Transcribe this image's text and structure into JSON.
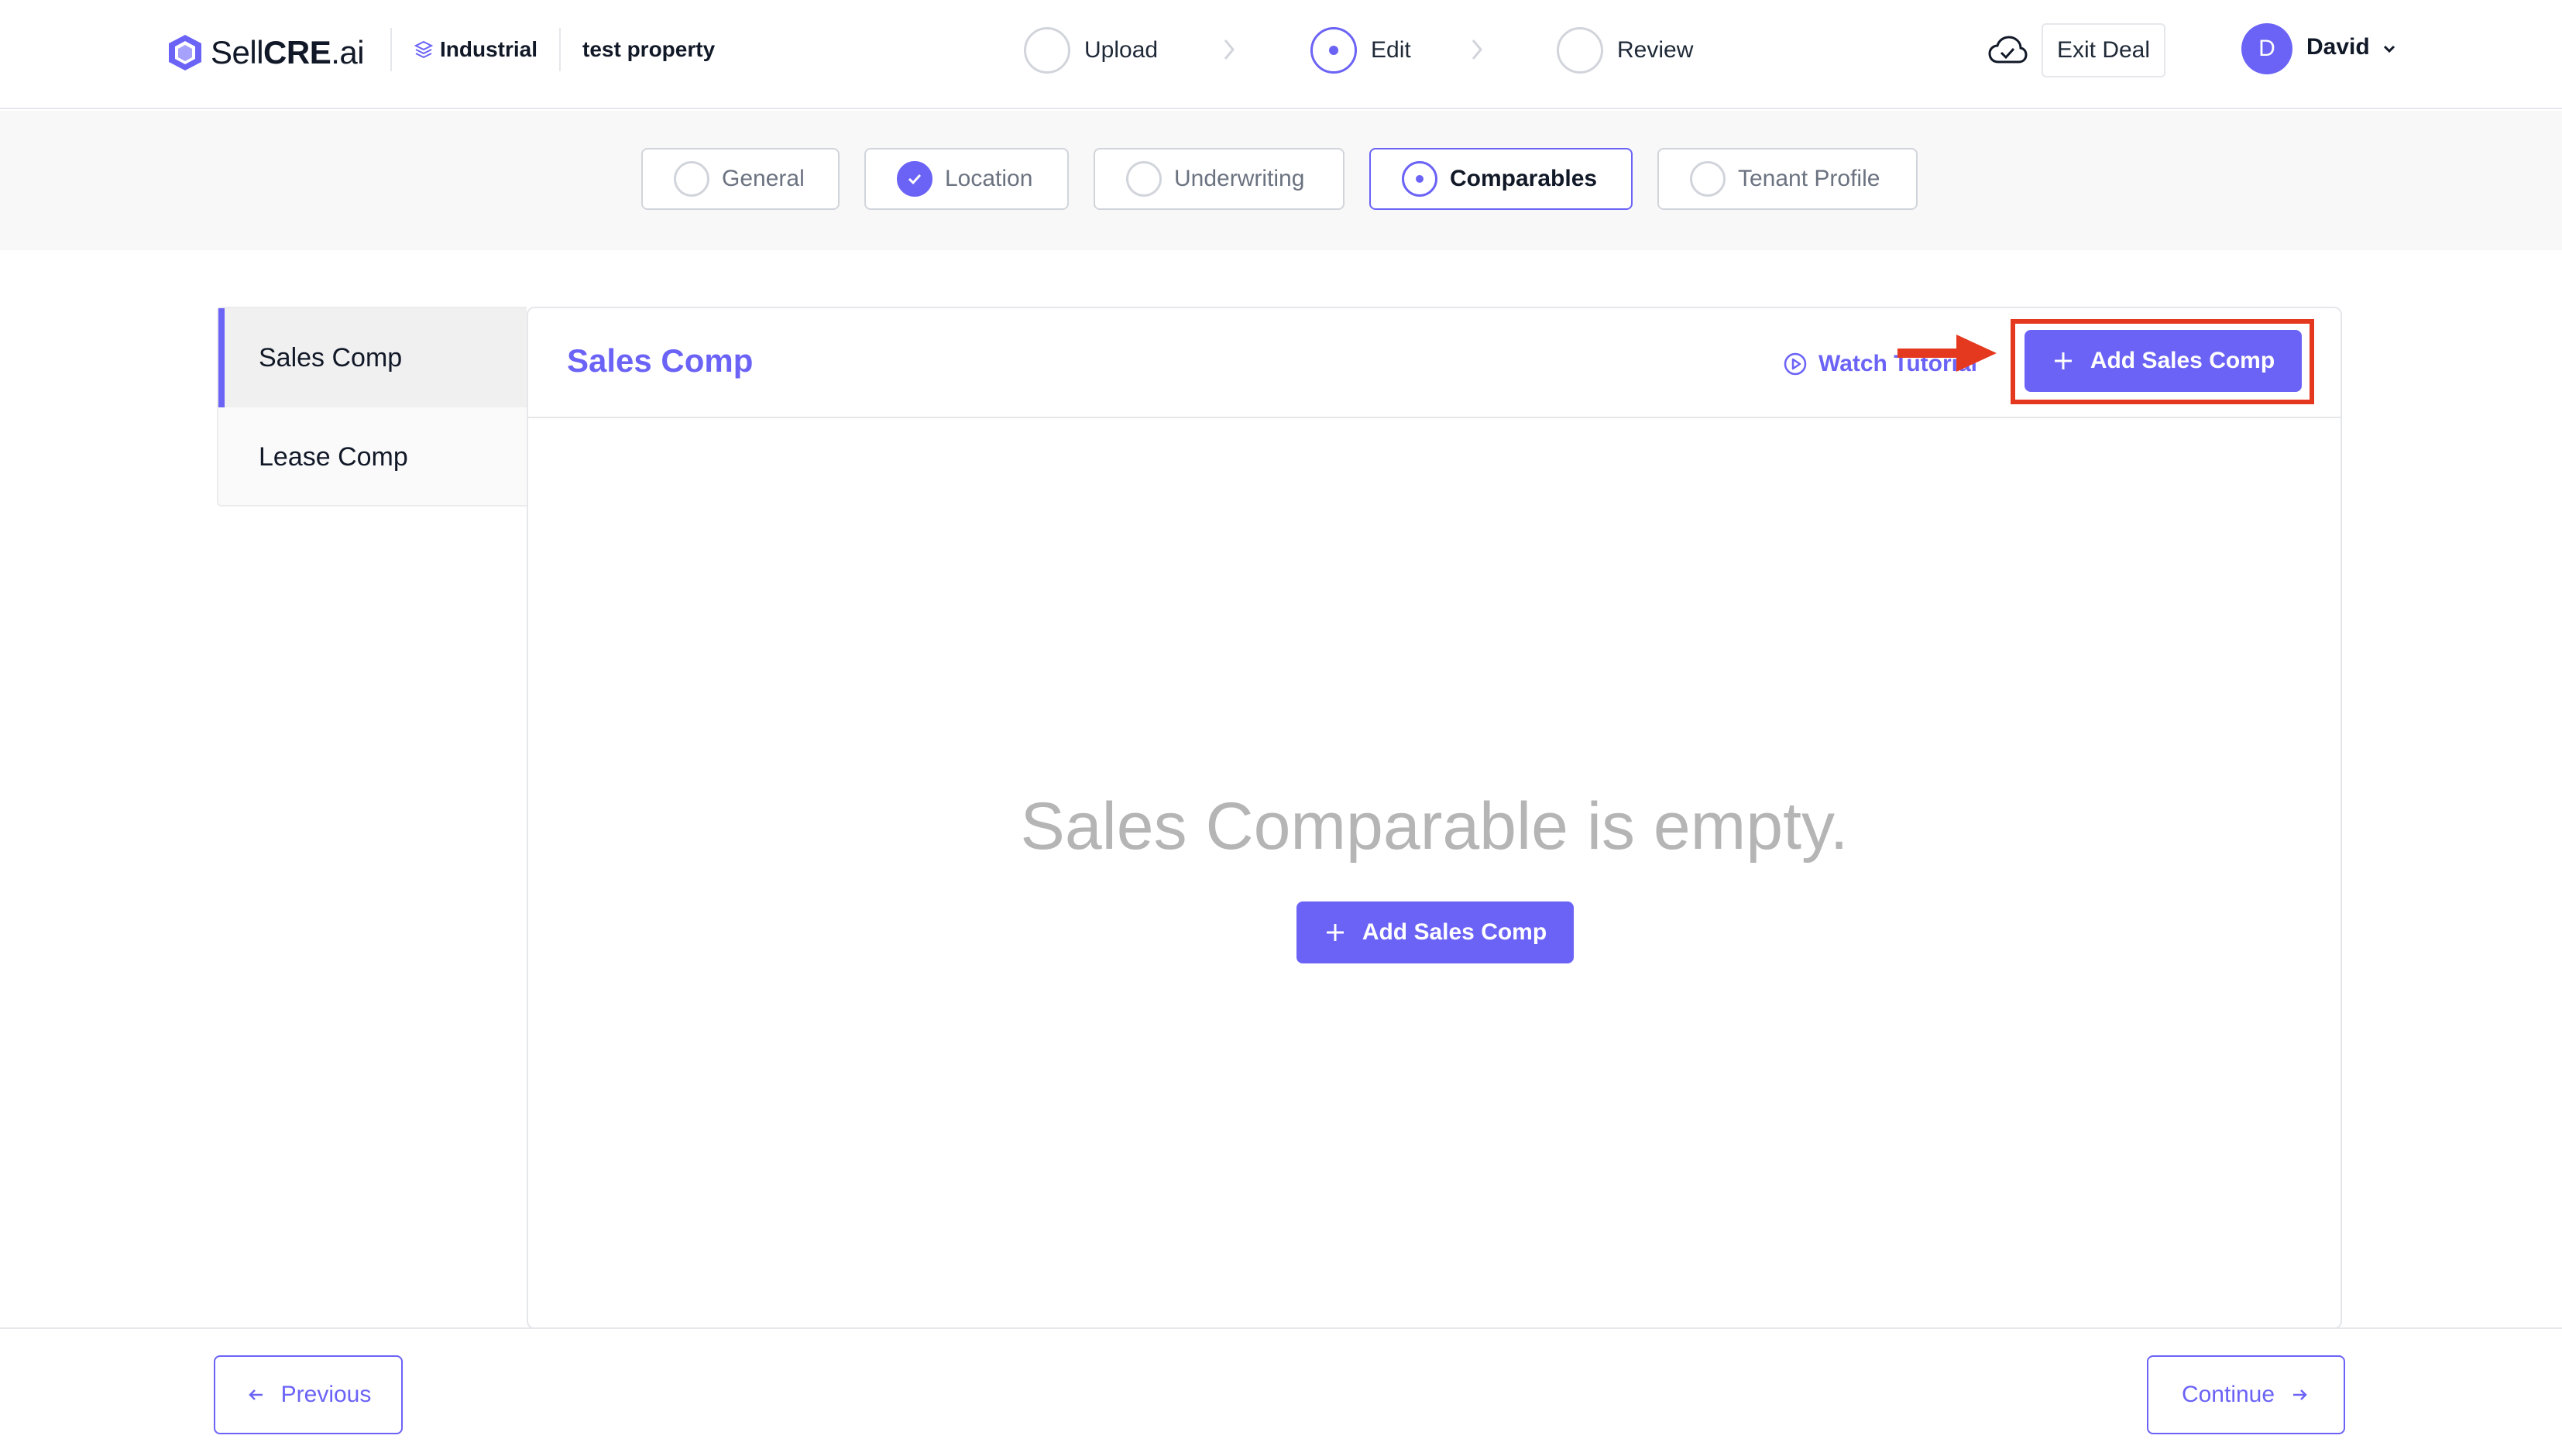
{
  "brand": {
    "name_light": "Sell",
    "name_bold": "CRE",
    "name_suffix": ".ai"
  },
  "breadcrumb": {
    "property_type": "Industrial",
    "property_name": "test property"
  },
  "steps": [
    {
      "label": "Upload",
      "state": "pending"
    },
    {
      "label": "Edit",
      "state": "active"
    },
    {
      "label": "Review",
      "state": "pending"
    }
  ],
  "header": {
    "exit_label": "Exit Deal",
    "user_initial": "D",
    "user_name": "David"
  },
  "tabs": [
    {
      "label": "General",
      "state": "pending"
    },
    {
      "label": "Location",
      "state": "complete"
    },
    {
      "label": "Underwriting",
      "state": "pending"
    },
    {
      "label": "Comparables",
      "state": "active"
    },
    {
      "label": "Tenant Profile",
      "state": "pending"
    }
  ],
  "sidebar": {
    "items": [
      {
        "label": "Sales Comp",
        "active": true
      },
      {
        "label": "Lease Comp",
        "active": false
      }
    ]
  },
  "panel": {
    "title": "Sales Comp",
    "watch_label": "Watch Tutorial",
    "add_label": "Add Sales Comp",
    "empty_message": "Sales Comparable is empty.",
    "empty_add_label": "Add Sales Comp"
  },
  "footer": {
    "previous_label": "Previous",
    "continue_label": "Continue"
  },
  "colors": {
    "accent": "#6b63f6",
    "highlight": "#e5391f"
  }
}
